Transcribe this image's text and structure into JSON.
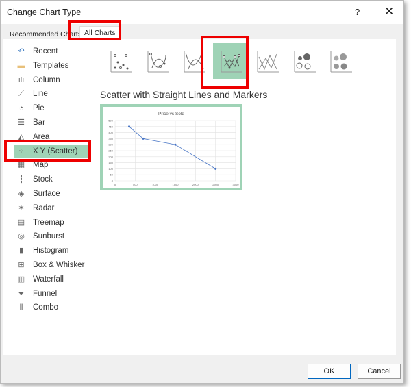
{
  "dialog": {
    "title": "Change Chart Type",
    "help_label": "?",
    "close_label": "✕"
  },
  "tabs": [
    {
      "label": "Recommended Charts"
    },
    {
      "label": "All Charts",
      "selected": true
    }
  ],
  "sidebar": {
    "items": [
      {
        "label": "Recent",
        "icon": "recent-icon"
      },
      {
        "label": "Templates",
        "icon": "folder-icon"
      },
      {
        "label": "Column",
        "icon": "column-chart-icon"
      },
      {
        "label": "Line",
        "icon": "line-chart-icon"
      },
      {
        "label": "Pie",
        "icon": "pie-chart-icon"
      },
      {
        "label": "Bar",
        "icon": "bar-chart-icon"
      },
      {
        "label": "Area",
        "icon": "area-chart-icon"
      },
      {
        "label": "X Y (Scatter)",
        "icon": "scatter-chart-icon",
        "selected": true
      },
      {
        "label": "Map",
        "icon": "map-icon"
      },
      {
        "label": "Stock",
        "icon": "stock-chart-icon"
      },
      {
        "label": "Surface",
        "icon": "surface-chart-icon"
      },
      {
        "label": "Radar",
        "icon": "radar-chart-icon"
      },
      {
        "label": "Treemap",
        "icon": "treemap-icon"
      },
      {
        "label": "Sunburst",
        "icon": "sunburst-icon"
      },
      {
        "label": "Histogram",
        "icon": "histogram-icon"
      },
      {
        "label": "Box & Whisker",
        "icon": "box-whisker-icon"
      },
      {
        "label": "Waterfall",
        "icon": "waterfall-icon"
      },
      {
        "label": "Funnel",
        "icon": "funnel-icon"
      },
      {
        "label": "Combo",
        "icon": "combo-chart-icon"
      }
    ]
  },
  "subtypes": [
    "scatter",
    "scatter-smooth-markers",
    "scatter-smooth",
    "scatter-straight-markers",
    "scatter-straight",
    "bubble",
    "bubble-3d"
  ],
  "selected_subtype_title": "Scatter with Straight Lines and Markers",
  "accent_color": "#9fd3b6",
  "highlight_color": "#e00000",
  "chart_data": {
    "type": "scatter",
    "title": "Price vs Sold",
    "x": [
      350,
      700,
      1500,
      2500
    ],
    "y": [
      450,
      350,
      300,
      100
    ],
    "xlim": [
      0,
      3000
    ],
    "ylim": [
      0,
      500
    ],
    "xticks": [
      "0",
      "500",
      "1000",
      "1500",
      "2000",
      "2500",
      "3000"
    ],
    "yticks": [
      "0",
      "50",
      "100",
      "150",
      "200",
      "250",
      "300",
      "350",
      "400",
      "450",
      "500"
    ],
    "grid": true,
    "color": "#4472c4"
  },
  "buttons": {
    "ok": "OK",
    "cancel": "Cancel"
  }
}
